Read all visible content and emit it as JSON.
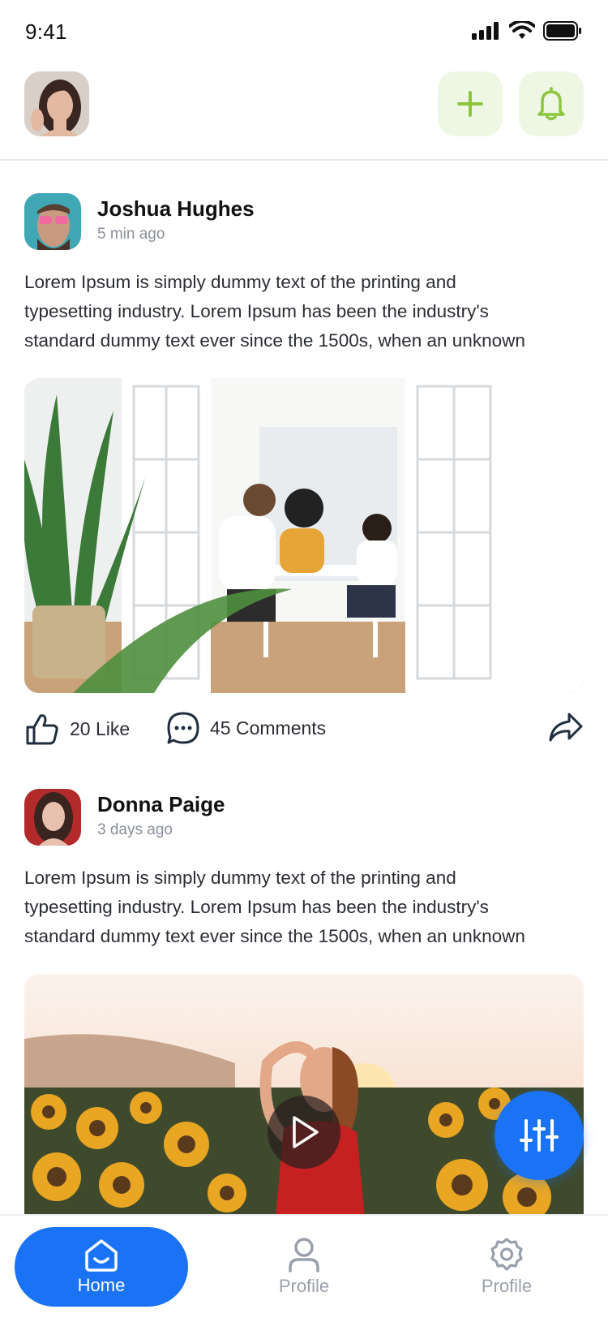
{
  "status_bar": {
    "time": "9:41"
  },
  "colors": {
    "accent": "#1a73f5",
    "soft_green": "#eef7e3",
    "icon_green": "#8cc63f",
    "muted": "#8a8f99"
  },
  "header": {
    "avatar": "user-avatar",
    "add_icon": "plus-icon",
    "bell_icon": "bell-icon"
  },
  "posts": [
    {
      "author": "Joshua Hughes",
      "time": "5 min ago",
      "text_lines": [
        "Lorem Ipsum is simply dummy text of the printing and",
        "typesetting industry. Lorem Ipsum has been the industry's",
        "standard dummy text ever since the 1500s, when an unknown"
      ],
      "likes": "20 Like",
      "comments": "45 Comments",
      "media": "photo"
    },
    {
      "author": "Donna Paige",
      "time": "3 days ago",
      "text_lines": [
        "Lorem Ipsum is simply dummy text of the printing and",
        "typesetting industry. Lorem Ipsum has been the industry's",
        "standard dummy text ever since the 1500s, when an unknown"
      ],
      "media": "video"
    }
  ],
  "fab": {
    "icon": "sliders-icon"
  },
  "nav": [
    {
      "label": "Home",
      "icon": "home-icon",
      "active": true
    },
    {
      "label": "Profile",
      "icon": "user-icon",
      "active": false
    },
    {
      "label": "Profile",
      "icon": "gear-icon",
      "active": false
    }
  ]
}
